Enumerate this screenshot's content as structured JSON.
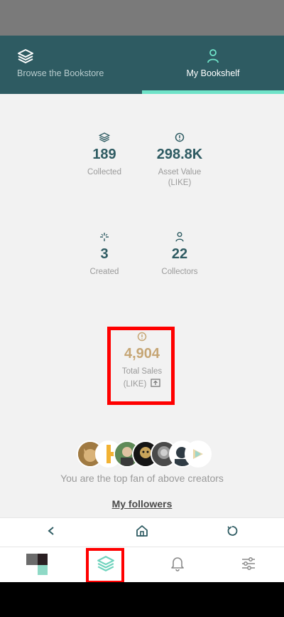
{
  "tabs": [
    {
      "label": "Browse the Bookstore",
      "icon": "layers-icon",
      "active": false
    },
    {
      "label": "My Bookshelf",
      "icon": "user-icon",
      "active": true
    }
  ],
  "stats": {
    "collected": {
      "value": "189",
      "label": "Collected",
      "icon": "layers-icon"
    },
    "asset_value": {
      "value": "298.8K",
      "label": "Asset Value",
      "unit": "(LIKE)",
      "icon": "info-icon"
    },
    "created": {
      "value": "3",
      "label": "Created",
      "icon": "sparkle-icon"
    },
    "collectors": {
      "value": "22",
      "label": "Collectors",
      "icon": "user-icon"
    },
    "total_sales": {
      "value": "4,904",
      "label": "Total Sales",
      "unit": "(LIKE)",
      "icon": "info-icon"
    }
  },
  "fans": {
    "text": "You are the top fan of above creators",
    "link": "My followers"
  },
  "browser_bar": {
    "icons": [
      "back-icon",
      "home-icon",
      "refresh-icon"
    ]
  },
  "bottom_nav": {
    "icons": [
      "app-logo-icon",
      "layers-icon",
      "bell-icon",
      "settings-sliders-icon"
    ]
  },
  "colors": {
    "primary": "#2e5b62",
    "accent": "#6fe3c8",
    "sales": "#c6a675",
    "highlight": "#ff0000"
  }
}
